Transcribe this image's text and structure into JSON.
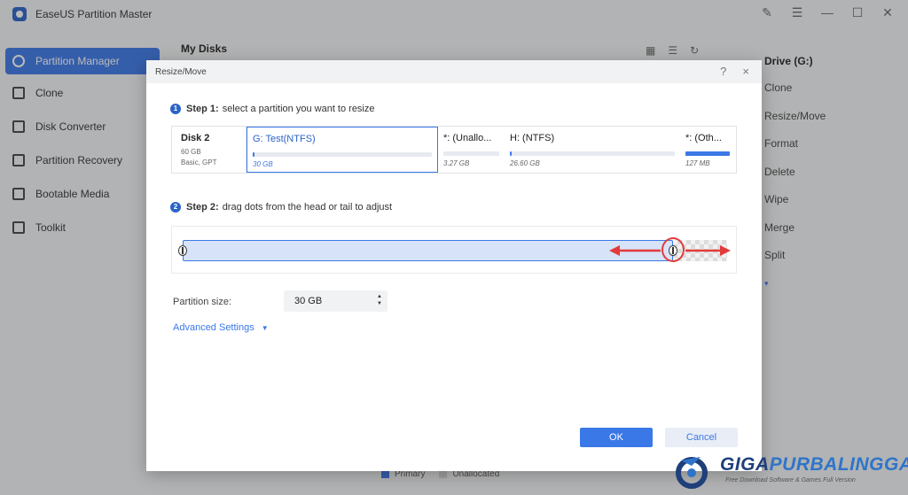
{
  "app": {
    "title": "EaseUS Partition Master",
    "window_controls": [
      "feedback-icon",
      "menu-icon",
      "minimize-icon",
      "maximize-icon",
      "close-icon"
    ]
  },
  "sidebar": {
    "items": [
      {
        "label": "Partition Manager",
        "icon": "pie-chart-icon",
        "active": true
      },
      {
        "label": "Clone",
        "icon": "clone-icon"
      },
      {
        "label": "Disk Converter",
        "icon": "disk-converter-icon"
      },
      {
        "label": "Partition Recovery",
        "icon": "recovery-icon"
      },
      {
        "label": "Bootable Media",
        "icon": "bootable-media-icon"
      },
      {
        "label": "Toolkit",
        "icon": "toolkit-icon"
      }
    ]
  },
  "main": {
    "header": "My Disks"
  },
  "right_panel": {
    "title": "Drive (G:)",
    "actions": [
      "Clone",
      "Resize/Move",
      "Format",
      "Delete",
      "Wipe",
      "Merge",
      "Split"
    ]
  },
  "legend": {
    "primary": "Primary",
    "unallocated": "Unallocated"
  },
  "dialog": {
    "title": "Resize/Move",
    "help": "?",
    "close": "×",
    "step1": {
      "num": "1",
      "label": "Step 1:",
      "text": "select a partition you want to resize"
    },
    "step2": {
      "num": "2",
      "label": "Step 2:",
      "text": "drag dots from the head or tail to adjust"
    },
    "disk": {
      "name": "Disk 2",
      "size": "60 GB",
      "type": "Basic, GPT"
    },
    "partitions": [
      {
        "name": "G: Test(NTFS)",
        "size": "30 GB",
        "used": 0.01,
        "selected": true
      },
      {
        "name": "*: (Unallo...",
        "size": "3.27 GB",
        "used": 0
      },
      {
        "name": "H: (NTFS)",
        "size": "26.60 GB",
        "used": 0.01
      },
      {
        "name": "*: (Oth...",
        "size": "127 MB",
        "used": 1
      }
    ],
    "slider": {
      "allocated_fraction": 0.9
    },
    "partition_size_label": "Partition size:",
    "partition_size_value": "30 GB",
    "advanced_settings": "Advanced Settings",
    "ok": "OK",
    "cancel": "Cancel"
  },
  "watermark": {
    "name_part1": "GIGA",
    "name_part2": "PURBALINGGA",
    "tagline": "Free Download Software & Games Full Version",
    "colors": {
      "dark": "#1e3f7a",
      "light": "#2f74c9"
    }
  },
  "colors": {
    "accent": "#3b78e7",
    "arrow": "#e23b3b"
  }
}
